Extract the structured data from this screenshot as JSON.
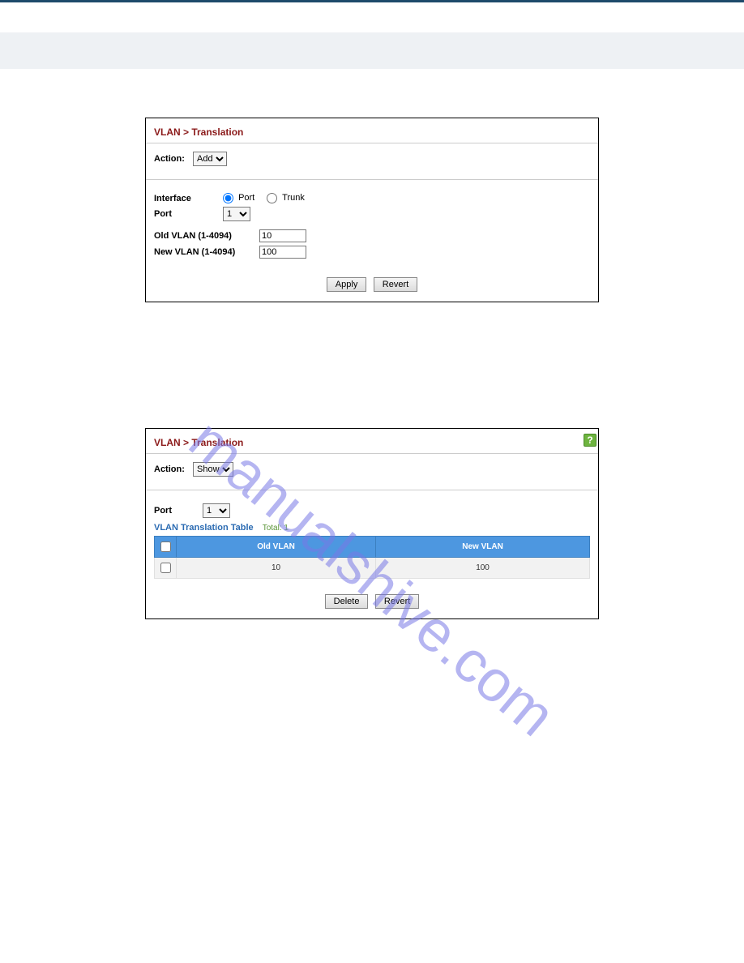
{
  "watermark": "manualshive.com",
  "panel1": {
    "title": "VLAN > Translation",
    "action_label": "Action:",
    "action_value": "Add",
    "interface_label": "Interface",
    "radio_port": "Port",
    "radio_trunk": "Trunk",
    "port_label": "Port",
    "port_value": "1",
    "old_vlan_label": "Old VLAN (1-4094)",
    "old_vlan_value": "10",
    "new_vlan_label": "New VLAN (1-4094)",
    "new_vlan_value": "100",
    "apply": "Apply",
    "revert": "Revert"
  },
  "panel2": {
    "title": "VLAN > Translation",
    "action_label": "Action:",
    "action_value": "Show",
    "port_label": "Port",
    "port_value": "1",
    "table_title": "VLAN Translation Table",
    "total_label": "Total:",
    "total_value": "1",
    "col_old": "Old VLAN",
    "col_new": "New VLAN",
    "rows": [
      {
        "old": "10",
        "new": "100"
      }
    ],
    "delete": "Delete",
    "revert": "Revert",
    "help": "?"
  }
}
